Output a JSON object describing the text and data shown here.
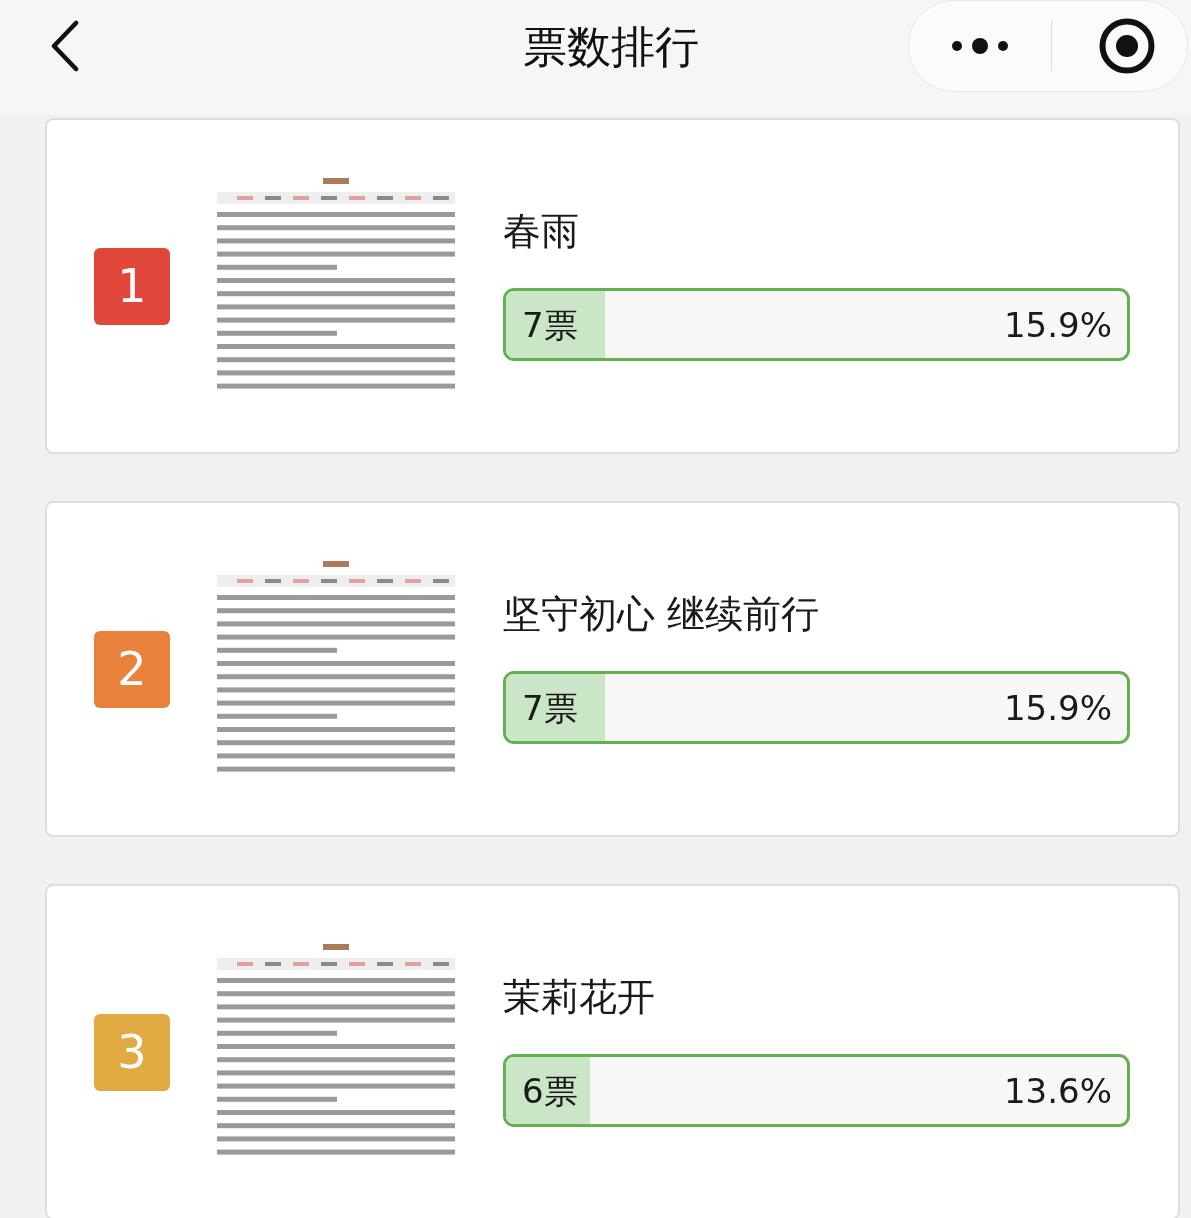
{
  "header": {
    "title": "票数排行"
  },
  "entries": [
    {
      "rank": "1",
      "color": "#e0463a",
      "title": "春雨",
      "votes": "7票",
      "percent": "15.9%",
      "level": 0.159
    },
    {
      "rank": "2",
      "color": "#e8813b",
      "title": "坚守初心 继续前行",
      "votes": "7票",
      "percent": "15.9%",
      "level": 0.159
    },
    {
      "rank": "3",
      "color": "#e1aa42",
      "title": "茉莉花开",
      "votes": "6票",
      "percent": "13.6%",
      "level": 0.136
    }
  ]
}
